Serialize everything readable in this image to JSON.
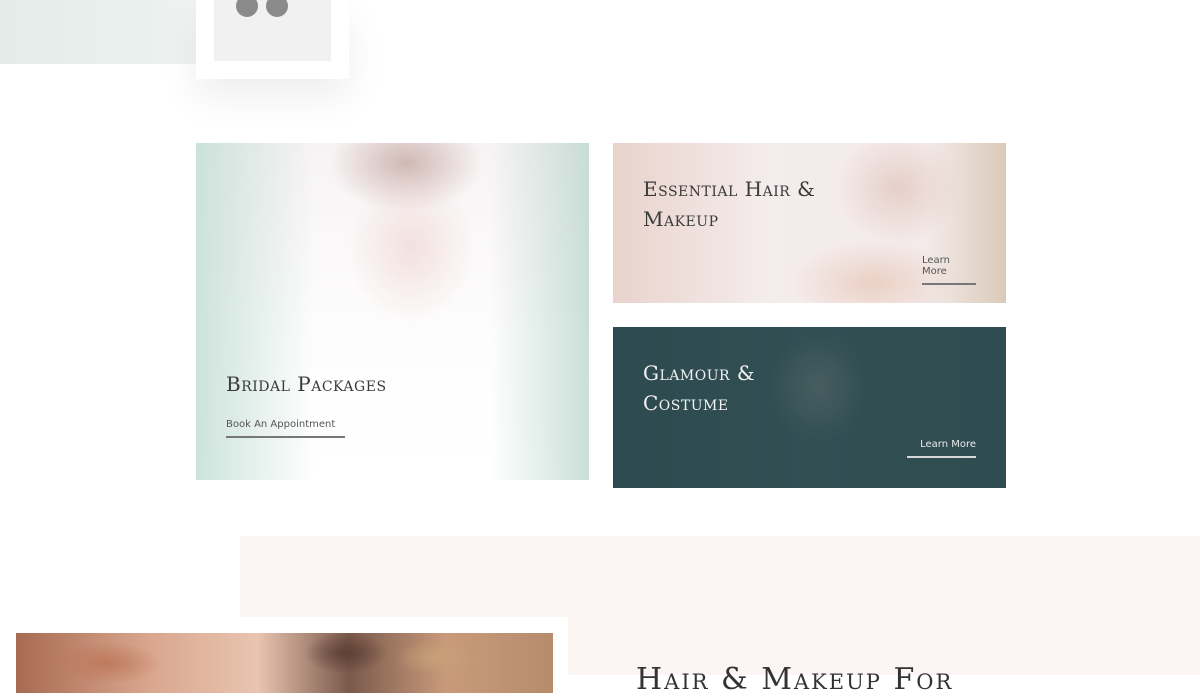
{
  "top": {
    "quote_icon": "quote-mark-icon"
  },
  "cards": {
    "bridal": {
      "title": "Bridal Packages",
      "link_label": "Book An Appointment"
    },
    "essential": {
      "title_line1": "Essential Hair &",
      "title_line2": "Makeup",
      "link_label": "Learn More"
    },
    "glamour": {
      "title_line1": "Glamour &",
      "title_line2": "Costume",
      "link_label": "Learn More"
    }
  },
  "bottom": {
    "heading": "Hair & Makeup For"
  },
  "colors": {
    "glamour_bg": "#2f4c51",
    "pink_band": "#fbf5f4",
    "top_band": "#e7eeeb"
  }
}
